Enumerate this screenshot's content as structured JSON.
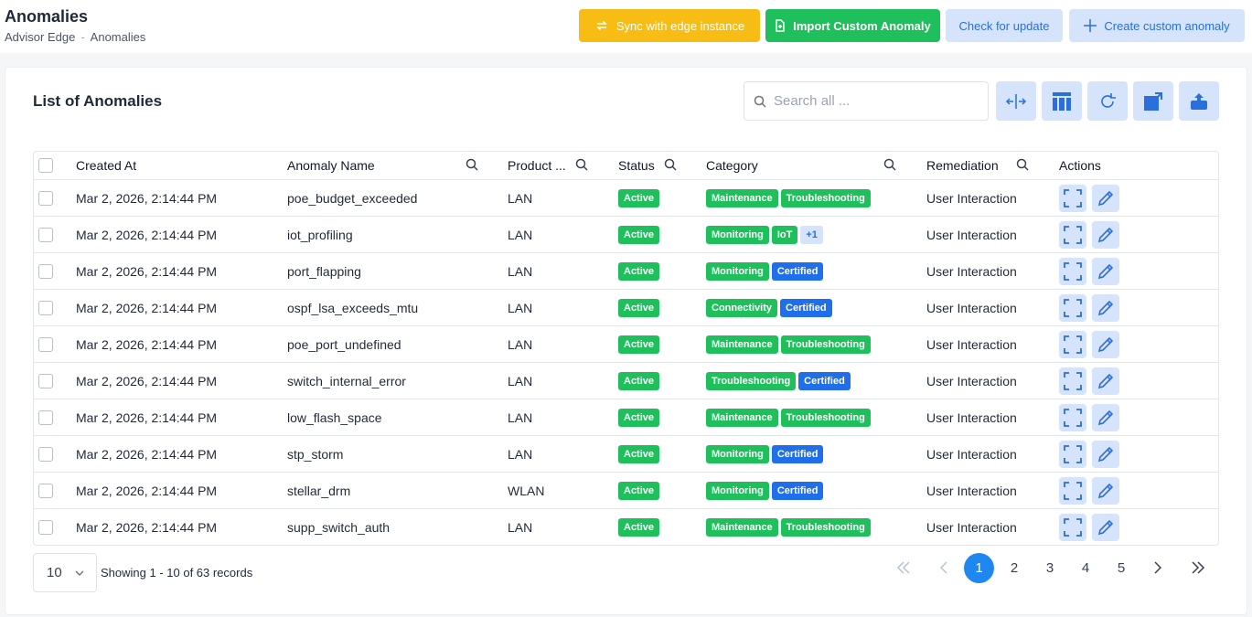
{
  "header": {
    "title": "Anomalies",
    "breadcrumb": [
      "Advisor Edge",
      "-",
      "Anomalies"
    ],
    "buttons": {
      "sync": "Sync with edge instance",
      "import": "Import Custom Anomaly",
      "check": "Check for update",
      "create": "Create custom anomaly"
    }
  },
  "card": {
    "title": "List of Anomalies",
    "search_placeholder": "Search all ..."
  },
  "table": {
    "columns": [
      "Created At",
      "Anomaly Name",
      "Product ...",
      "Status",
      "Category",
      "Remediation",
      "Actions"
    ],
    "rows": [
      {
        "created": "Mar 2, 2026, 2:14:44 PM",
        "name": "poe_budget_exceeded",
        "product": "LAN",
        "status": "Active",
        "tags": [
          "Maintenance",
          "Troubleshooting"
        ],
        "remediation": "User Interaction"
      },
      {
        "created": "Mar 2, 2026, 2:14:44 PM",
        "name": "iot_profiling",
        "product": "LAN",
        "status": "Active",
        "tags": [
          "Monitoring",
          "IoT",
          "+1"
        ],
        "remediation": "User Interaction"
      },
      {
        "created": "Mar 2, 2026, 2:14:44 PM",
        "name": "port_flapping",
        "product": "LAN",
        "status": "Active",
        "tags": [
          "Monitoring",
          "Certified"
        ],
        "remediation": "User Interaction"
      },
      {
        "created": "Mar 2, 2026, 2:14:44 PM",
        "name": "ospf_lsa_exceeds_mtu",
        "product": "LAN",
        "status": "Active",
        "tags": [
          "Connectivity",
          "Certified"
        ],
        "remediation": "User Interaction"
      },
      {
        "created": "Mar 2, 2026, 2:14:44 PM",
        "name": "poe_port_undefined",
        "product": "LAN",
        "status": "Active",
        "tags": [
          "Maintenance",
          "Troubleshooting"
        ],
        "remediation": "User Interaction"
      },
      {
        "created": "Mar 2, 2026, 2:14:44 PM",
        "name": "switch_internal_error",
        "product": "LAN",
        "status": "Active",
        "tags": [
          "Troubleshooting",
          "Certified"
        ],
        "remediation": "User Interaction"
      },
      {
        "created": "Mar 2, 2026, 2:14:44 PM",
        "name": "low_flash_space",
        "product": "LAN",
        "status": "Active",
        "tags": [
          "Maintenance",
          "Troubleshooting"
        ],
        "remediation": "User Interaction"
      },
      {
        "created": "Mar 2, 2026, 2:14:44 PM",
        "name": "stp_storm",
        "product": "LAN",
        "status": "Active",
        "tags": [
          "Monitoring",
          "Certified"
        ],
        "remediation": "User Interaction"
      },
      {
        "created": "Mar 2, 2026, 2:14:44 PM",
        "name": "stellar_drm",
        "product": "WLAN",
        "status": "Active",
        "tags": [
          "Monitoring",
          "Certified"
        ],
        "remediation": "User Interaction"
      },
      {
        "created": "Mar 2, 2026, 2:14:44 PM",
        "name": "supp_switch_auth",
        "product": "LAN",
        "status": "Active",
        "tags": [
          "Maintenance",
          "Troubleshooting"
        ],
        "remediation": "User Interaction"
      }
    ]
  },
  "footer": {
    "page_size": "10",
    "records_text": "Showing 1 - 10 of 63 records",
    "pages": [
      "1",
      "2",
      "3",
      "4",
      "5"
    ],
    "current_page": "1"
  },
  "colors": {
    "accent": "#1f87f0",
    "sync": "#f7bd14",
    "import": "#1fbf5c",
    "active_badge": "#1fbf5c",
    "certified_badge": "#1f6feb"
  },
  "icons": {
    "sync": "sync-icon",
    "import": "file-import-icon",
    "create": "plus-icon",
    "search": "search-icon",
    "toolbar": [
      "column-resize-icon",
      "columns-layout-icon",
      "refresh-icon",
      "export-icon",
      "upload-icon"
    ],
    "row_actions": [
      "expand-icon",
      "edit-pencil-icon"
    ]
  }
}
